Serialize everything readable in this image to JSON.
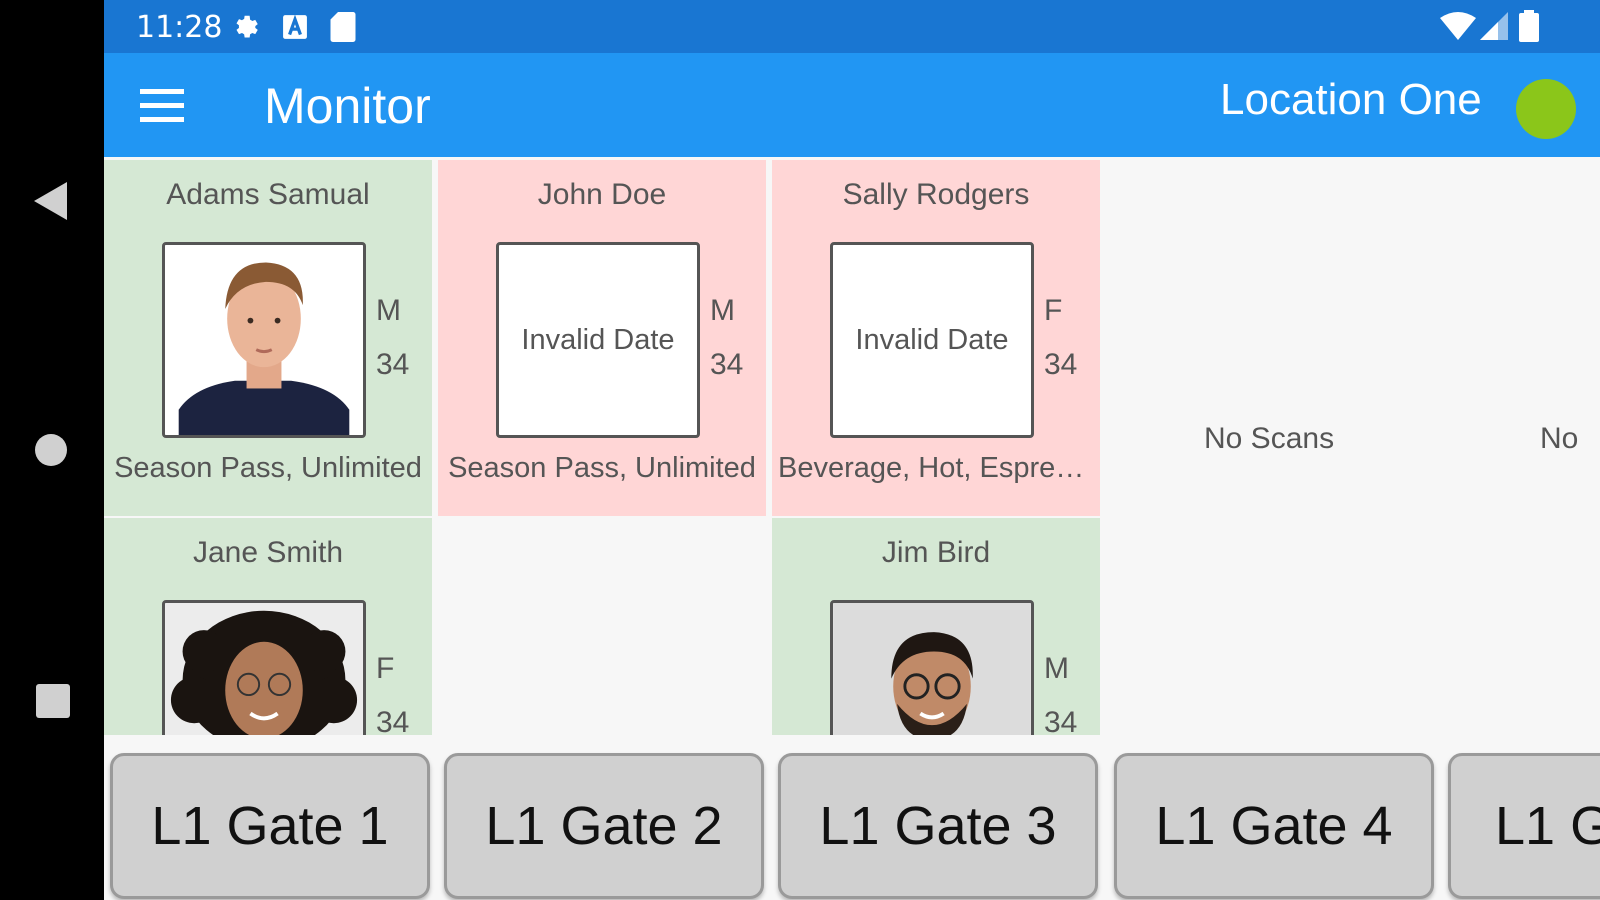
{
  "status_bar": {
    "time": "11:28",
    "icons": [
      "gear-icon",
      "a-box-icon",
      "sd-card-icon",
      "wifi-icon",
      "signal-icon",
      "battery-icon"
    ]
  },
  "app_bar": {
    "title": "Monitor",
    "location": "Location One",
    "status_color": "#8bc61a"
  },
  "colors": {
    "valid": "#d5e8d4",
    "invalid": "#ffd6d6",
    "appbar": "#2196f3",
    "statusbar": "#1976d2"
  },
  "gates": [
    {
      "label": "L1 Gate 1",
      "scans": [
        {
          "name": "Adams Samual",
          "gender": "M",
          "age": "34",
          "desc": "Season Pass, Unlimited",
          "status": "valid",
          "photo": "male-photo"
        },
        {
          "name": "Jane Smith",
          "gender": "F",
          "age": "34",
          "status": "valid",
          "photo": "female-photo"
        }
      ]
    },
    {
      "label": "L1 Gate 2",
      "scans": [
        {
          "name": "John Doe",
          "gender": "M",
          "age": "34",
          "desc": "Season Pass, Unlimited",
          "status": "invalid",
          "photo_text": "Invalid Date"
        }
      ]
    },
    {
      "label": "L1 Gate 3",
      "scans": [
        {
          "name": "Sally Rodgers",
          "gender": "F",
          "age": "34",
          "desc": "Beverage, Hot, Espresso",
          "status": "invalid",
          "photo_text": "Invalid Date"
        },
        {
          "name": "Jim Bird",
          "gender": "M",
          "age": "34",
          "status": "valid",
          "photo": "male-glasses-photo"
        }
      ]
    },
    {
      "label": "L1 Gate 4",
      "no_scans": "No Scans"
    },
    {
      "label": "L1 G",
      "no_scans": "No"
    }
  ]
}
